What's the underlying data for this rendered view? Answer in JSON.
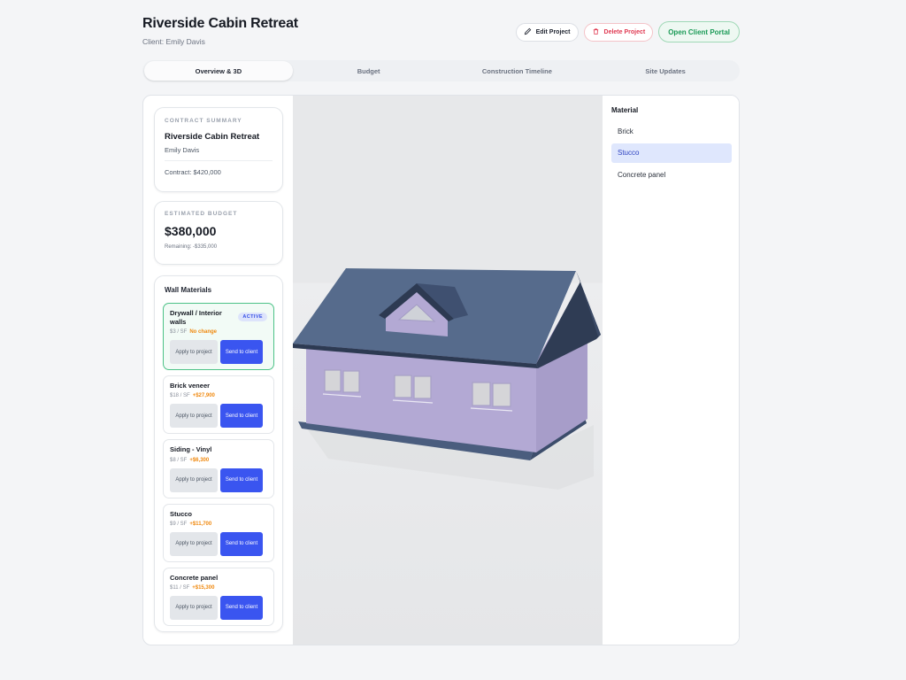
{
  "header": {
    "title": "Riverside Cabin Retreat",
    "client": "Client: Emily Davis",
    "edit_label": "Edit Project",
    "delete_label": "Delete Project",
    "portal_label": "Open Client Portal"
  },
  "tabs": [
    {
      "label": "Overview & 3D",
      "active": true
    },
    {
      "label": "Budget"
    },
    {
      "label": "Construction Timeline"
    },
    {
      "label": "Site Updates"
    }
  ],
  "contract": {
    "label": "CONTRACT SUMMARY",
    "name": "Riverside Cabin Retreat",
    "client": "Emily Davis",
    "amount": "Contract: $420,000"
  },
  "budget": {
    "label": "ESTIMATED BUDGET",
    "value": "$380,000",
    "remaining": "Remaining: -$335,000"
  },
  "walls": {
    "title": "Wall Materials",
    "active_badge": "ACTIVE",
    "apply_label": "Apply to project",
    "send_label": "Send to client",
    "items": [
      {
        "name": "Drywall / Interior walls",
        "price": "$3 / SF",
        "delta": "No change"
      },
      {
        "name": "Brick veneer",
        "price": "$18 / SF",
        "delta": "+$27,900"
      },
      {
        "name": "Siding - Vinyl",
        "price": "$8 / SF",
        "delta": "+$6,300"
      },
      {
        "name": "Stucco",
        "price": "$9 / SF",
        "delta": "+$11,700"
      },
      {
        "name": "Concrete panel",
        "price": "$11 / SF",
        "delta": "+$15,300"
      }
    ]
  },
  "material_panel": {
    "title": "Material",
    "options": [
      "Brick",
      "Stucco",
      "Concrete panel"
    ],
    "selected": "Stucco"
  },
  "colors": {
    "accent": "#3a55f0",
    "active_green": "#4cc287",
    "delta_orange": "#f0890f",
    "roof": "#4b5f80",
    "walls": "#b3a8d6"
  },
  "icons": {
    "edit": "pencil-icon",
    "delete": "trash-icon"
  }
}
